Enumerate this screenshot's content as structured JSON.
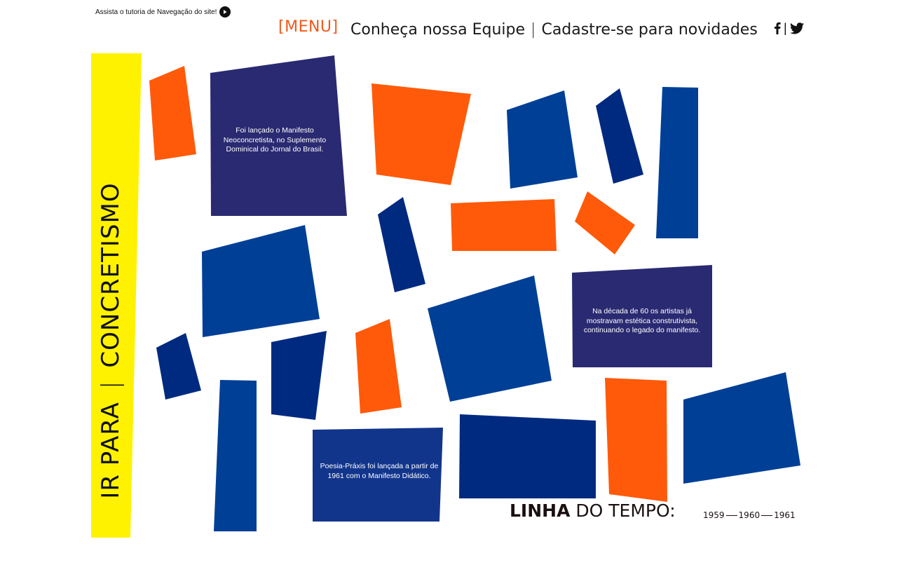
{
  "header": {
    "tutorial_text": "Assista o tutoria de Navegação do site!",
    "menu_label": "[MENU]",
    "nav_team": "Conheça nossa Equipe",
    "nav_separator": "|",
    "nav_signup": "Cadastre-se para novidades",
    "social_separator": "|"
  },
  "side": {
    "goto_label": "IR PARA",
    "separator": "|",
    "destination": "CONCRETISMO"
  },
  "info_boxes": {
    "box1": "Foi lançado o Manifesto Neoconcretista, no Suplemento Dominical do Jornal do Brasil.",
    "box2": "Na década de 60 os artistas já mostravam estética construtivista, continuando o legado do manifesto.",
    "box3": "Poesia-Práxis foi lançada a partir de 1961 com o Manifesto Didático."
  },
  "timeline": {
    "title_bold": "LINHA",
    "title_rest": " DO TEMPO:",
    "years": [
      "1959",
      "1960",
      "1961"
    ]
  },
  "colors": {
    "yellow": "#fff200",
    "orange": "#ff5a0a",
    "blue": "#003f96",
    "navy": "#002a80",
    "indigo": "#2a2a72",
    "box_blue": "#12358c"
  }
}
